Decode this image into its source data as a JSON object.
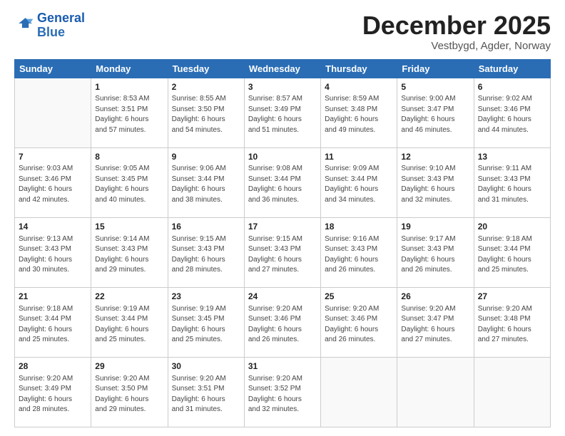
{
  "header": {
    "logo_line1": "General",
    "logo_line2": "Blue",
    "month": "December 2025",
    "location": "Vestbygd, Agder, Norway"
  },
  "weekdays": [
    "Sunday",
    "Monday",
    "Tuesday",
    "Wednesday",
    "Thursday",
    "Friday",
    "Saturday"
  ],
  "weeks": [
    [
      {
        "day": null,
        "info": null
      },
      {
        "day": "1",
        "info": "Sunrise: 8:53 AM\nSunset: 3:51 PM\nDaylight: 6 hours\nand 57 minutes."
      },
      {
        "day": "2",
        "info": "Sunrise: 8:55 AM\nSunset: 3:50 PM\nDaylight: 6 hours\nand 54 minutes."
      },
      {
        "day": "3",
        "info": "Sunrise: 8:57 AM\nSunset: 3:49 PM\nDaylight: 6 hours\nand 51 minutes."
      },
      {
        "day": "4",
        "info": "Sunrise: 8:59 AM\nSunset: 3:48 PM\nDaylight: 6 hours\nand 49 minutes."
      },
      {
        "day": "5",
        "info": "Sunrise: 9:00 AM\nSunset: 3:47 PM\nDaylight: 6 hours\nand 46 minutes."
      },
      {
        "day": "6",
        "info": "Sunrise: 9:02 AM\nSunset: 3:46 PM\nDaylight: 6 hours\nand 44 minutes."
      }
    ],
    [
      {
        "day": "7",
        "info": "Sunrise: 9:03 AM\nSunset: 3:46 PM\nDaylight: 6 hours\nand 42 minutes."
      },
      {
        "day": "8",
        "info": "Sunrise: 9:05 AM\nSunset: 3:45 PM\nDaylight: 6 hours\nand 40 minutes."
      },
      {
        "day": "9",
        "info": "Sunrise: 9:06 AM\nSunset: 3:44 PM\nDaylight: 6 hours\nand 38 minutes."
      },
      {
        "day": "10",
        "info": "Sunrise: 9:08 AM\nSunset: 3:44 PM\nDaylight: 6 hours\nand 36 minutes."
      },
      {
        "day": "11",
        "info": "Sunrise: 9:09 AM\nSunset: 3:44 PM\nDaylight: 6 hours\nand 34 minutes."
      },
      {
        "day": "12",
        "info": "Sunrise: 9:10 AM\nSunset: 3:43 PM\nDaylight: 6 hours\nand 32 minutes."
      },
      {
        "day": "13",
        "info": "Sunrise: 9:11 AM\nSunset: 3:43 PM\nDaylight: 6 hours\nand 31 minutes."
      }
    ],
    [
      {
        "day": "14",
        "info": "Sunrise: 9:13 AM\nSunset: 3:43 PM\nDaylight: 6 hours\nand 30 minutes."
      },
      {
        "day": "15",
        "info": "Sunrise: 9:14 AM\nSunset: 3:43 PM\nDaylight: 6 hours\nand 29 minutes."
      },
      {
        "day": "16",
        "info": "Sunrise: 9:15 AM\nSunset: 3:43 PM\nDaylight: 6 hours\nand 28 minutes."
      },
      {
        "day": "17",
        "info": "Sunrise: 9:15 AM\nSunset: 3:43 PM\nDaylight: 6 hours\nand 27 minutes."
      },
      {
        "day": "18",
        "info": "Sunrise: 9:16 AM\nSunset: 3:43 PM\nDaylight: 6 hours\nand 26 minutes."
      },
      {
        "day": "19",
        "info": "Sunrise: 9:17 AM\nSunset: 3:43 PM\nDaylight: 6 hours\nand 26 minutes."
      },
      {
        "day": "20",
        "info": "Sunrise: 9:18 AM\nSunset: 3:44 PM\nDaylight: 6 hours\nand 25 minutes."
      }
    ],
    [
      {
        "day": "21",
        "info": "Sunrise: 9:18 AM\nSunset: 3:44 PM\nDaylight: 6 hours\nand 25 minutes."
      },
      {
        "day": "22",
        "info": "Sunrise: 9:19 AM\nSunset: 3:44 PM\nDaylight: 6 hours\nand 25 minutes."
      },
      {
        "day": "23",
        "info": "Sunrise: 9:19 AM\nSunset: 3:45 PM\nDaylight: 6 hours\nand 25 minutes."
      },
      {
        "day": "24",
        "info": "Sunrise: 9:20 AM\nSunset: 3:46 PM\nDaylight: 6 hours\nand 26 minutes."
      },
      {
        "day": "25",
        "info": "Sunrise: 9:20 AM\nSunset: 3:46 PM\nDaylight: 6 hours\nand 26 minutes."
      },
      {
        "day": "26",
        "info": "Sunrise: 9:20 AM\nSunset: 3:47 PM\nDaylight: 6 hours\nand 27 minutes."
      },
      {
        "day": "27",
        "info": "Sunrise: 9:20 AM\nSunset: 3:48 PM\nDaylight: 6 hours\nand 27 minutes."
      }
    ],
    [
      {
        "day": "28",
        "info": "Sunrise: 9:20 AM\nSunset: 3:49 PM\nDaylight: 6 hours\nand 28 minutes."
      },
      {
        "day": "29",
        "info": "Sunrise: 9:20 AM\nSunset: 3:50 PM\nDaylight: 6 hours\nand 29 minutes."
      },
      {
        "day": "30",
        "info": "Sunrise: 9:20 AM\nSunset: 3:51 PM\nDaylight: 6 hours\nand 31 minutes."
      },
      {
        "day": "31",
        "info": "Sunrise: 9:20 AM\nSunset: 3:52 PM\nDaylight: 6 hours\nand 32 minutes."
      },
      {
        "day": null,
        "info": null
      },
      {
        "day": null,
        "info": null
      },
      {
        "day": null,
        "info": null
      }
    ]
  ]
}
